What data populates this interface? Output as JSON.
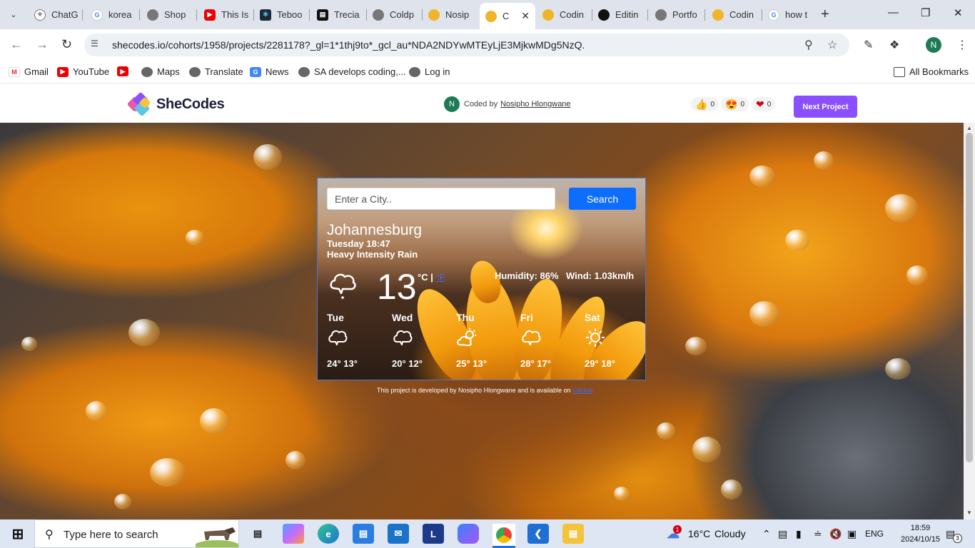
{
  "browser": {
    "tabs": [
      {
        "label": "ChatG",
        "icon": "chatgpt-icon"
      },
      {
        "label": "korea",
        "icon": "google-icon"
      },
      {
        "label": "Shop",
        "icon": "globe-icon"
      },
      {
        "label": "This Is",
        "icon": "youtube-icon"
      },
      {
        "label": "Teboo",
        "icon": "react-icon"
      },
      {
        "label": "Trecia",
        "icon": "tv-icon"
      },
      {
        "label": "Coldp",
        "icon": "globe-icon"
      },
      {
        "label": "Nosip",
        "icon": "shecodes-icon"
      },
      {
        "label": "C",
        "icon": "shecodes-icon",
        "active": true
      },
      {
        "label": "Codin",
        "icon": "shecodes-icon"
      },
      {
        "label": "Editin",
        "icon": "github-icon"
      },
      {
        "label": "Portfo",
        "icon": "globe-icon"
      },
      {
        "label": "Codin",
        "icon": "shecodes-icon"
      },
      {
        "label": "how t",
        "icon": "google-icon"
      }
    ],
    "url": "shecodes.io/cohorts/1958/projects/2281178?_gl=1*1thj9to*_gcl_au*NDA2NDYwMTEyLjE3MjkwMDg5NzQ.",
    "profile_initial": "N",
    "bookmarks": [
      "Gmail",
      "YouTube",
      "",
      "Maps",
      "Translate",
      "News",
      "SA develops coding,...",
      "Log in"
    ],
    "all_bookmarks": "All Bookmarks"
  },
  "shecodes": {
    "logo": "SheCodes",
    "coded_by_prefix": "Coded by",
    "author": "Nosipho Hlongwane",
    "author_initial": "N",
    "reactions": [
      {
        "icon": "thumbs-up",
        "count": "0"
      },
      {
        "icon": "heart-eyes",
        "count": "0"
      },
      {
        "icon": "heart",
        "count": "0"
      }
    ],
    "next_project": "Next Project"
  },
  "weather": {
    "search_placeholder": "Enter a City..",
    "search_button": "Search",
    "city": "Johannesburg",
    "datetime": "Tuesday 18:47",
    "description": "Heavy Intensity Rain",
    "temperature": "13",
    "unit_c": "°C |",
    "unit_f": "°F",
    "humidity": "Humidity: 86%",
    "wind": "Wind: 1.03km/h",
    "forecast": [
      {
        "day": "Tue",
        "icon": "cloud",
        "temps": "24° 13°"
      },
      {
        "day": "Wed",
        "icon": "cloud",
        "temps": "20° 12°"
      },
      {
        "day": "Thu",
        "icon": "partly-sunny",
        "temps": "25° 13°"
      },
      {
        "day": "Fri",
        "icon": "cloud",
        "temps": "28° 17°"
      },
      {
        "day": "Sat",
        "icon": "sun",
        "temps": "29° 18°"
      }
    ],
    "credit_text": "This project is developed by Nosipho Hlongwane and is available on",
    "credit_link": "GitHub"
  },
  "taskbar": {
    "search_placeholder": "Type here to search",
    "weather_temp": "16°C",
    "weather_desc": "Cloudy",
    "weather_badge": "1",
    "language": "ENG",
    "time": "18:59",
    "date": "2024/10/15",
    "notifications": "3"
  }
}
